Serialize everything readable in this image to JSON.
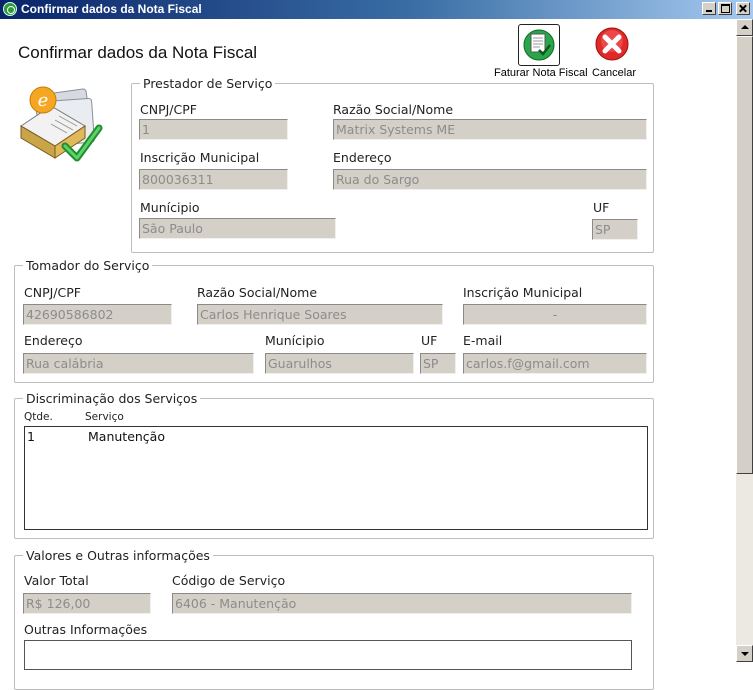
{
  "window": {
    "title": "Confirmar dados da Nota Fiscal"
  },
  "page": {
    "heading": "Confirmar dados da Nota Fiscal"
  },
  "toolbar": {
    "faturar_label": "Faturar Nota Fiscal",
    "cancelar_label": "Cancelar"
  },
  "prestador": {
    "legend": "Prestador de Serviço",
    "cnpj_label": "CNPJ/CPF",
    "cnpj_value": "1",
    "razao_label": "Razão Social/Nome",
    "razao_value": "Matrix Systems ME",
    "inscricao_label": "Inscrição Municipal",
    "inscricao_value": "800036311",
    "endereco_label": "Endereço",
    "endereco_value": "Rua do Sargo",
    "municipio_label": "Munícipio",
    "municipio_value": "São Paulo",
    "uf_label": "UF",
    "uf_value": "SP"
  },
  "tomador": {
    "legend": "Tomador do Serviço",
    "cnpj_label": "CNPJ/CPF",
    "cnpj_value": "42690586802",
    "razao_label": "Razão Social/Nome",
    "razao_value": "Carlos Henrique Soares",
    "inscricao_label": "Inscrição Municipal",
    "inscricao_value": "-",
    "endereco_label": "Endereço",
    "endereco_value": "Rua calábria",
    "municipio_label": "Munícipio",
    "municipio_value": "Guarulhos",
    "uf_label": "UF",
    "uf_value": "SP",
    "email_label": "E-mail",
    "email_value": "carlos.f@gmail.com"
  },
  "servicos": {
    "legend": "Discriminação dos Serviços",
    "col_qtde": "Qtde.",
    "col_servico": "Serviço",
    "items": [
      {
        "qtde": "1",
        "servico": "Manutenção"
      }
    ]
  },
  "valores": {
    "legend": "Valores e Outras informações",
    "valor_label": "Valor Total",
    "valor_value": "R$ 126,00",
    "codigo_label": "Código de Serviço",
    "codigo_value": "6406 - Manutenção",
    "outras_label": "Outras Informações"
  }
}
